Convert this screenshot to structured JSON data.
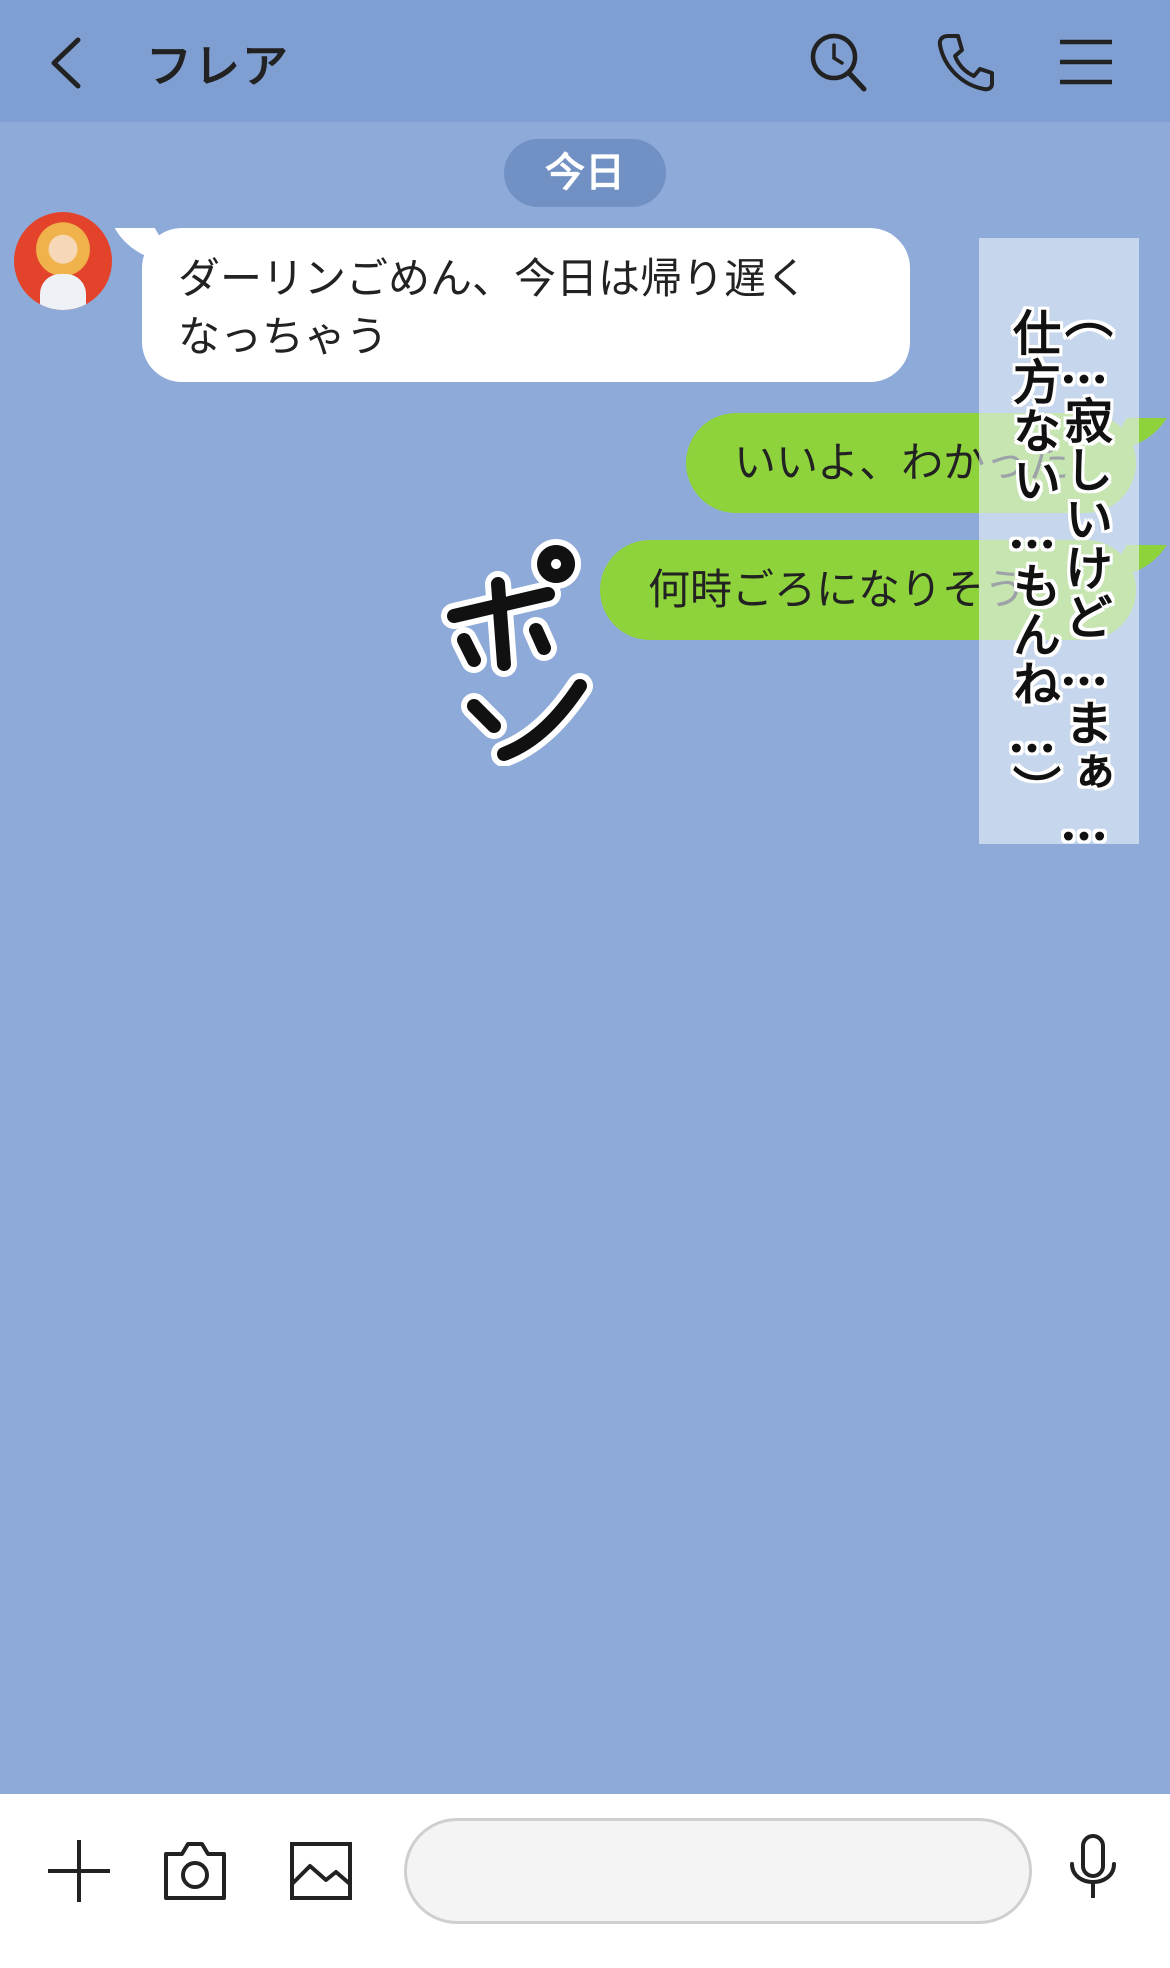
{
  "header": {
    "back_icon": "chevron-left-icon",
    "title": "フレア",
    "icons": [
      "search-icon",
      "phone-icon",
      "menu-icon"
    ]
  },
  "date_divider": "今日",
  "messages": [
    {
      "side": "received",
      "text_line1": "ダーリンごめん、今日は帰り遅く",
      "text_line2": "なっちゃう"
    },
    {
      "side": "sent",
      "text": "いいよ、わかった"
    },
    {
      "side": "sent",
      "text": "何時ごろになりそう"
    }
  ],
  "overlay": {
    "line1": "（…寂しいけど…まぁ…",
    "line2": "仕方ない…もんね…）"
  },
  "sound_effect": "ポン",
  "bottom_bar": {
    "icons": [
      "plus-icon",
      "camera-icon",
      "image-icon",
      "microphone-icon"
    ],
    "input_placeholder": ""
  },
  "colors": {
    "background": "#8eaad8",
    "header": "#7f9fd3",
    "sent_bubble": "#8ed33b",
    "received_bubble": "#ffffff",
    "date_pill": "#7190c4"
  }
}
